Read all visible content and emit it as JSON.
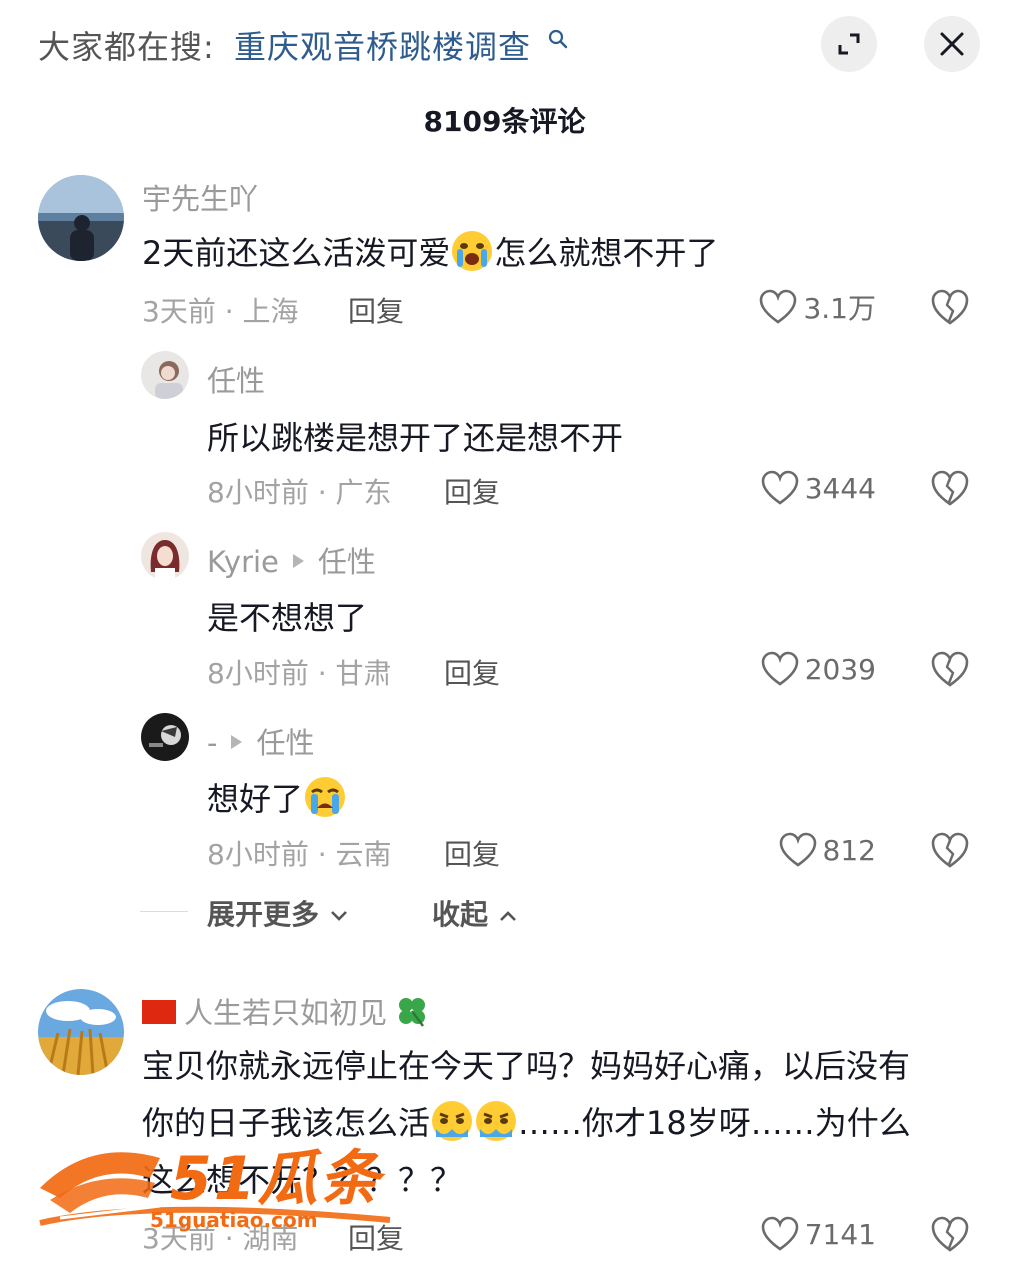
{
  "header": {
    "search_prefix": "大家都在搜:",
    "search_term": "重庆观音桥跳楼调查",
    "comment_count": "8109条评论"
  },
  "comments": [
    {
      "username": "宇先生吖",
      "text_before_emoji": "2天前还这么活泼可爱",
      "text_after_emoji": "怎么就想不开了",
      "meta": "3天前 · 上海",
      "reply_label": "回复",
      "likes": "3.1万"
    },
    {
      "username": "任性",
      "text": "所以跳楼是想开了还是想不开",
      "meta": "8小时前 · 广东",
      "reply_label": "回复",
      "likes": "3444"
    },
    {
      "username": "Kyrie",
      "reply_to": "任性",
      "text": "是不想想了",
      "meta": "8小时前 · 甘肃",
      "reply_label": "回复",
      "likes": "2039"
    },
    {
      "username": "-",
      "reply_to": "任性",
      "text": "想好了",
      "meta": "8小时前 · 云南",
      "reply_label": "回复",
      "likes": "812"
    },
    {
      "username": "人生若只如初见",
      "text_line1": "宝贝你就永远停止在今天了吗？妈妈好心痛，以后没有",
      "text_line2_before": "你的日子我该怎么活",
      "text_line2_after": "……你才18岁呀……为什么",
      "text_line3": "这么想不开？？？？？",
      "meta": "3天前 · 湖南",
      "reply_label": "回复",
      "likes": "7141"
    }
  ],
  "thread_controls": {
    "expand_more": "展开更多",
    "collapse": "收起"
  },
  "watermark": {
    "brand": "51瓜条",
    "url": "51guatiao.com"
  },
  "colors": {
    "search_term": "#2f5c8e",
    "watermark": "#f26a12"
  }
}
